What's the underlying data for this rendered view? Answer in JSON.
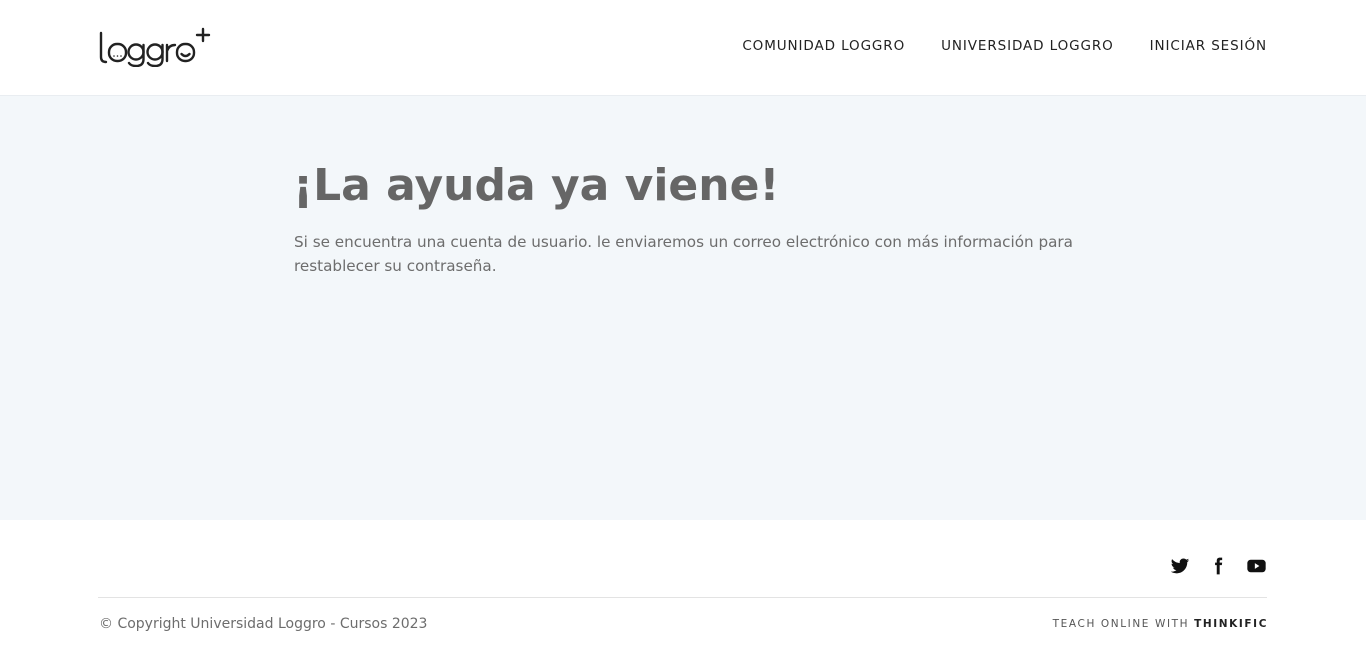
{
  "header": {
    "logo_text": "loggro+",
    "nav": [
      {
        "label": "COMUNIDAD LOGGRO"
      },
      {
        "label": "UNIVERSIDAD LOGGRO"
      },
      {
        "label": "INICIAR SESIÓN"
      }
    ]
  },
  "main": {
    "title": "¡La ayuda ya viene!",
    "description": "Si se encuentra una cuenta de usuario. le enviaremos un correo electrónico con más información para restablecer su contraseña."
  },
  "footer": {
    "social_icons": [
      "twitter-icon",
      "facebook-icon",
      "youtube-icon"
    ],
    "copyright": "© Copyright Universidad Loggro - Cursos 2023",
    "powered_prefix": "TEACH ONLINE WITH",
    "powered_brand": "THINKIFIC"
  },
  "colors": {
    "header_bg": "#ffffff",
    "main_bg": "#f3f7fa",
    "title": "#666666",
    "text": "#6d6d6d"
  }
}
